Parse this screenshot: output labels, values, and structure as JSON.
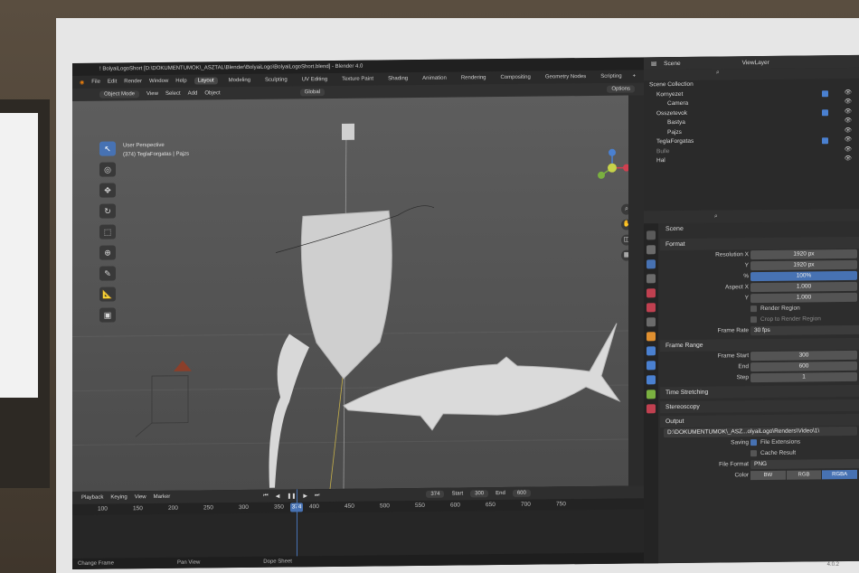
{
  "app": {
    "title": "! BolyaiLogoShort [D:\\DOKUMENTUMOK\\_ASZTAL\\Blender\\BolyaiLogo\\BolyaiLogoShort.blend] - Blender 4.0"
  },
  "menu": [
    "File",
    "Edit",
    "Render",
    "Window",
    "Help"
  ],
  "workspaces": [
    "Layout",
    "Modeling",
    "Sculpting",
    "UV Editing",
    "Texture Paint",
    "Shading",
    "Animation",
    "Rendering",
    "Compositing",
    "Geometry Nodes",
    "Scripting"
  ],
  "active_workspace": "Layout",
  "viewport_header": {
    "mode": "Object Mode",
    "menus": [
      "View",
      "Select",
      "Add",
      "Object"
    ],
    "orientation": "Global",
    "options": "Options"
  },
  "viewport": {
    "perspective": "User Perspective",
    "collection_info": "(374) TeglaForgatas | Pajzs"
  },
  "timeline": {
    "menus": [
      "Playback",
      "Keying",
      "View",
      "Marker"
    ],
    "current_frame": "374",
    "start_label": "Start",
    "start_value": "300",
    "end_label": "End",
    "end_value": "600",
    "ticks": [
      "100",
      "150",
      "200",
      "250",
      "300",
      "350",
      "400",
      "450",
      "500",
      "550",
      "600",
      "650",
      "700",
      "750"
    ],
    "status": [
      "Change Frame",
      "Pan View",
      "Dope Sheet"
    ]
  },
  "outliner": {
    "scene_label": "Scene",
    "viewlayer_label": "ViewLayer",
    "rows": [
      {
        "label": "Scene Collection",
        "indent": 0
      },
      {
        "label": "Kornyezet",
        "indent": 1
      },
      {
        "label": "Camera",
        "indent": 2
      },
      {
        "label": "Osszetevok",
        "indent": 1
      },
      {
        "label": "Bastya",
        "indent": 2
      },
      {
        "label": "Pajzs",
        "indent": 2
      },
      {
        "label": "TeglaForgatas",
        "indent": 1
      },
      {
        "label": "Bulle",
        "indent": 1
      },
      {
        "label": "Hal",
        "indent": 1
      }
    ]
  },
  "properties": {
    "context": "Scene",
    "format": {
      "header": "Format",
      "resolution_x_label": "Resolution X",
      "resolution_x": "1920 px",
      "resolution_y_label": "Y",
      "resolution_y": "1920 px",
      "percent_label": "%",
      "percent": "100%",
      "aspect_x_label": "Aspect X",
      "aspect_x": "1.000",
      "aspect_y_label": "Y",
      "aspect_y": "1.000",
      "render_region": "Render Region",
      "crop_region": "Crop to Render Region",
      "frame_rate_label": "Frame Rate",
      "frame_rate": "30 fps"
    },
    "frame_range": {
      "header": "Frame Range",
      "start_label": "Frame Start",
      "start": "300",
      "end_label": "End",
      "end": "600",
      "step_label": "Step",
      "step": "1"
    },
    "time_stretching": "Time Stretching",
    "stereoscopy": "Stereoscopy",
    "output": {
      "header": "Output",
      "path": "D:\\DOKUMENTUMOK\\_ASZ...olyaiLogo\\Renders\\Video\\1\\",
      "saving_label": "Saving",
      "file_extensions": "File Extensions",
      "cache_result": "Cache Result",
      "file_format_label": "File Format",
      "file_format": "PNG",
      "color_label": "Color",
      "color_options": [
        "BW",
        "RGB",
        "RGBA"
      ],
      "color_active": "RGBA"
    }
  },
  "version": "4.0.2"
}
